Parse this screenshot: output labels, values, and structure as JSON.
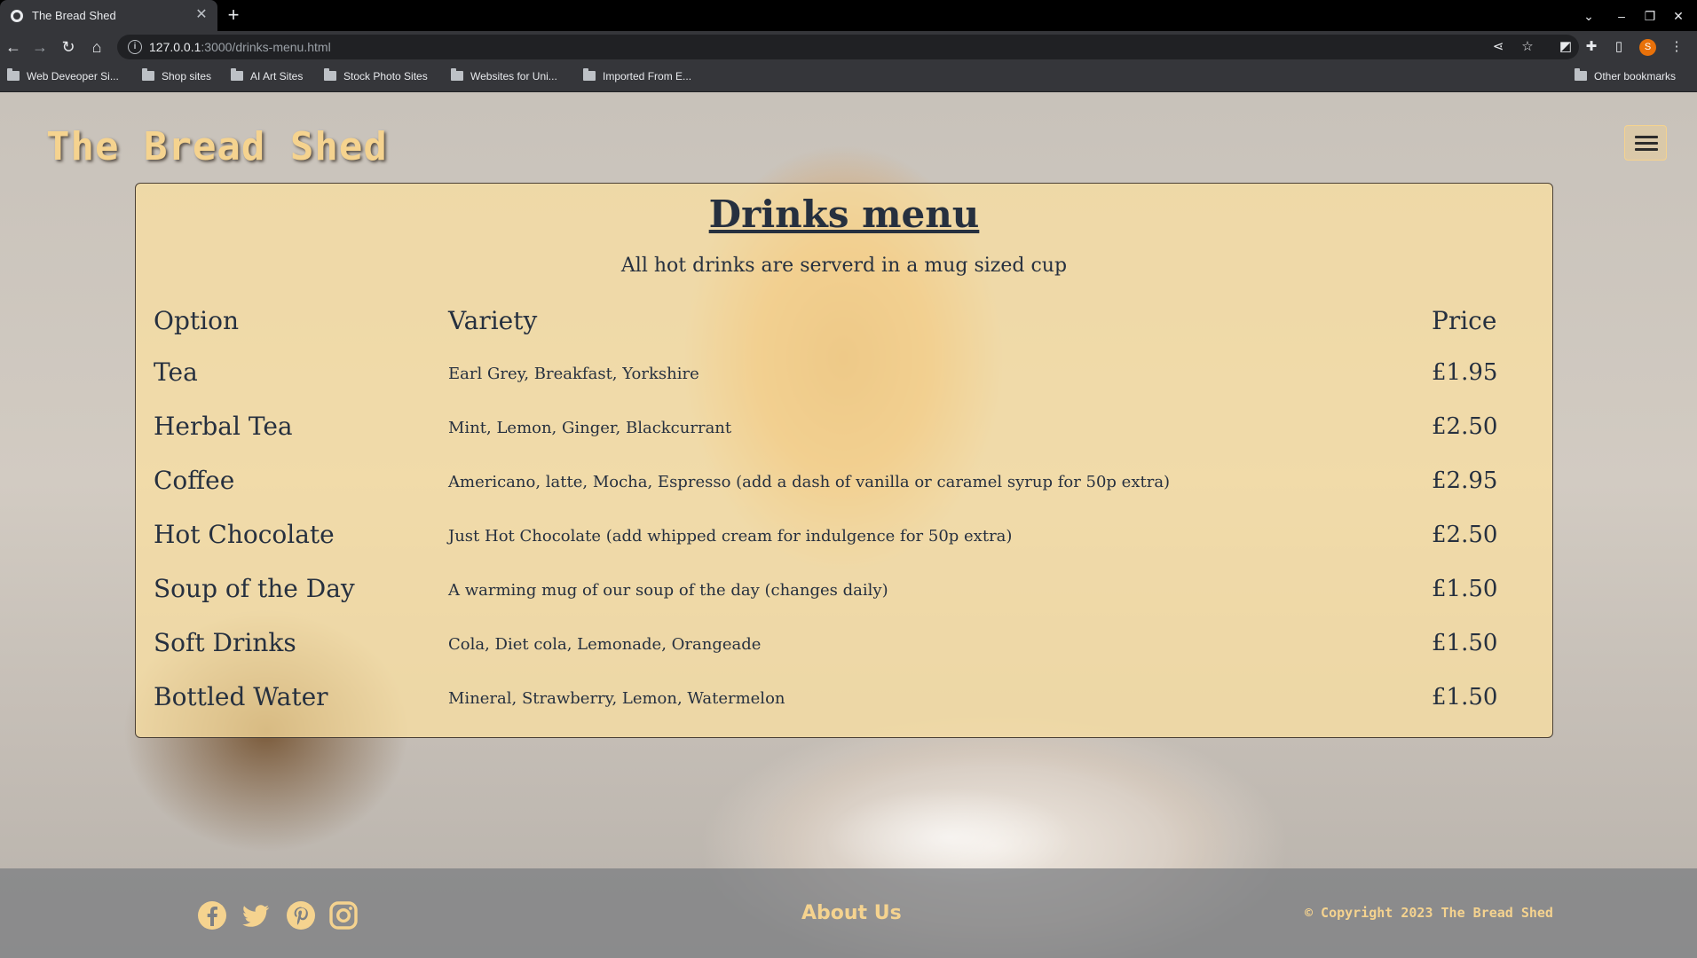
{
  "browser": {
    "tab_title": "The Bread Shed",
    "url_host": "127.0.0.1",
    "url_path": ":3000/drinks-menu.html",
    "bookmarks": [
      "Web Deveoper Si...",
      "Shop sites",
      "AI Art Sites",
      "Stock Photo Sites",
      "Websites for Uni...",
      "Imported From E..."
    ],
    "other_bookmarks": "Other bookmarks",
    "profile_initial": "S"
  },
  "site": {
    "title": "The Bread Shed"
  },
  "menu": {
    "heading": "Drinks menu",
    "subheading": "All hot drinks are serverd in a mug sized cup",
    "columns": [
      "Option",
      "Variety",
      "Price"
    ],
    "rows": [
      {
        "option": "Tea",
        "variety": "Earl Grey, Breakfast, Yorkshire",
        "price": "£1.95"
      },
      {
        "option": "Herbal Tea",
        "variety": "Mint, Lemon, Ginger, Blackcurrant",
        "price": "£2.50"
      },
      {
        "option": "Coffee",
        "variety": "Americano, latte, Mocha, Espresso (add a dash of vanilla or caramel syrup for 50p extra)",
        "price": "£2.95"
      },
      {
        "option": "Hot Chocolate",
        "variety": "Just Hot Chocolate (add whipped cream for indulgence for 50p extra)",
        "price": "£2.50"
      },
      {
        "option": "Soup of the Day",
        "variety": "A warming mug of our soup of the day (changes daily)",
        "price": "£1.50"
      },
      {
        "option": "Soft Drinks",
        "variety": "Cola, Diet cola, Lemonade, Orangeade",
        "price": "£1.50"
      },
      {
        "option": "Bottled Water",
        "variety": "Mineral, Strawberry, Lemon, Watermelon",
        "price": "£1.50"
      }
    ]
  },
  "footer": {
    "social": [
      "facebook-icon",
      "twitter-icon",
      "pinterest-icon",
      "instagram-icon"
    ],
    "about_label": "About Us",
    "copyright": "© Copyright 2023 The Bread Shed"
  },
  "colors": {
    "accent": "#f5d38f",
    "card_bg": "#fce1a0",
    "text_dark": "#26303f"
  }
}
